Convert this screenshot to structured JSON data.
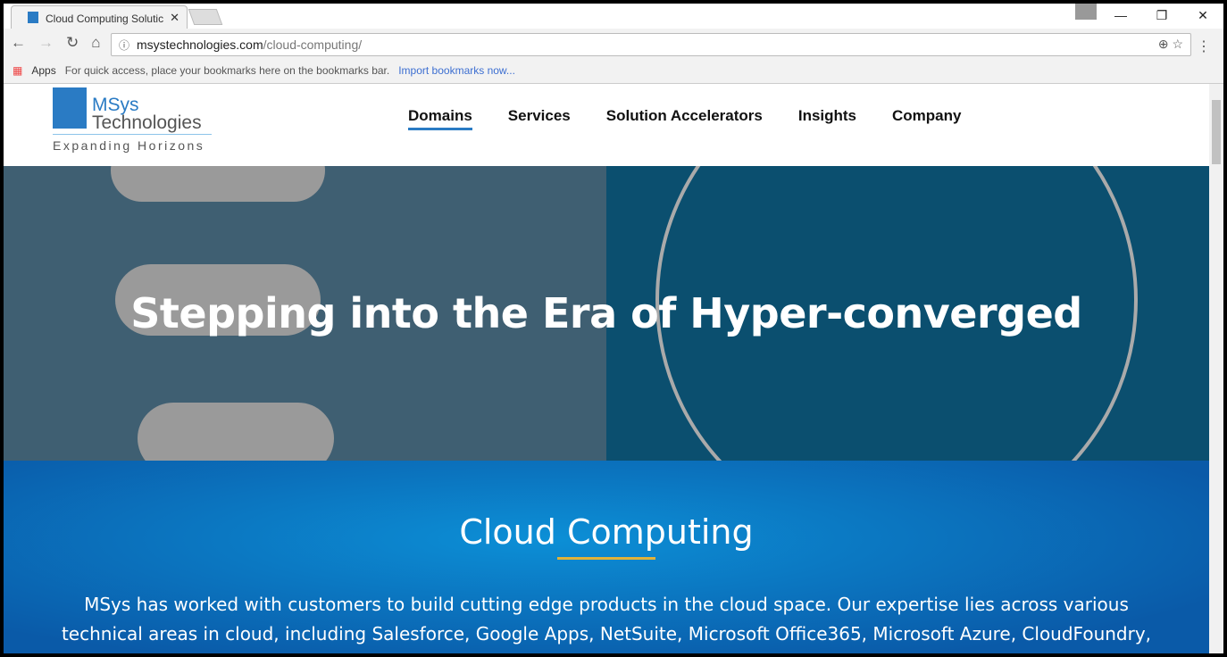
{
  "browser": {
    "tab_title": "Cloud Computing Solutic",
    "url_domain": "msystechnologies.com",
    "url_path": "/cloud-computing/",
    "bookmarks": {
      "apps": "Apps",
      "hint": "For quick access, place your bookmarks here on the bookmarks bar.",
      "import": "Import bookmarks now..."
    }
  },
  "site": {
    "logo": {
      "name1": "MSys",
      "name2": "Technologies",
      "tagline": "Expanding Horizons"
    },
    "nav": [
      {
        "label": "Domains",
        "active": true
      },
      {
        "label": "Services"
      },
      {
        "label": "Solution Accelerators"
      },
      {
        "label": "Insights"
      },
      {
        "label": "Company"
      }
    ],
    "hero": {
      "title": "Stepping into the Era of Hyper-converged"
    },
    "section": {
      "title": "Cloud Computing",
      "text": "MSys has worked with customers to build cutting edge products in the cloud space. Our expertise lies across various technical areas in cloud, including Salesforce, Google Apps, NetSuite, Microsoft Office365, Microsoft Azure, CloudFoundry, CloudBees, CumuLogic,"
    },
    "accent": "#2a7bc4",
    "underline": "#e1b23a"
  }
}
